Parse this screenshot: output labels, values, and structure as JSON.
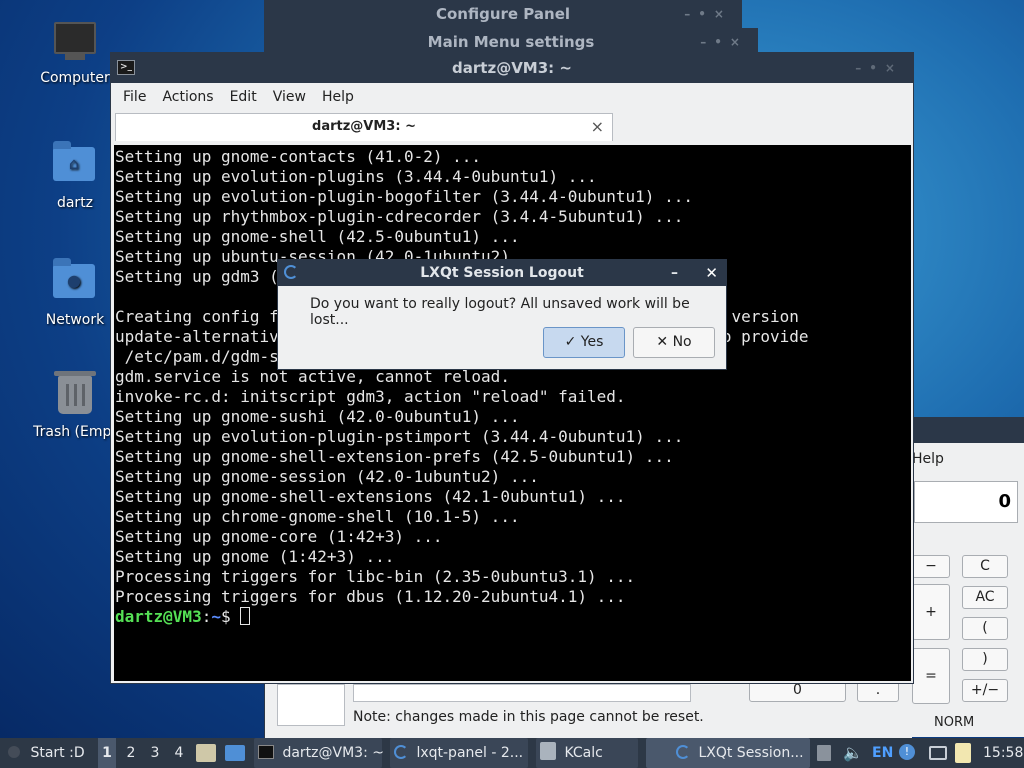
{
  "desktop": {
    "icons": [
      {
        "label": "Computer",
        "icon": "computer-icon"
      },
      {
        "label": "dartz",
        "icon": "home-folder-icon"
      },
      {
        "label": "Network",
        "icon": "network-folder-icon"
      },
      {
        "label": "Trash (Empt",
        "icon": "trash-icon"
      }
    ]
  },
  "background_windows": {
    "configure_panel_title": "Configure Panel",
    "main_menu_title": "Main Menu settings",
    "note": "Note: changes made in this page cannot be reset."
  },
  "terminal": {
    "window_title": "dartz@VM3: ~",
    "menu": [
      "File",
      "Actions",
      "Edit",
      "View",
      "Help"
    ],
    "tab_title": "dartz@VM3: ~",
    "lines": [
      "Setting up gnome-contacts (41.0-2) ...",
      "Setting up evolution-plugins (3.44.4-0ubuntu1) ...",
      "Setting up evolution-plugin-bogofilter (3.44.4-0ubuntu1) ...",
      "Setting up rhythmbox-plugin-cdrecorder (3.4.4-5ubuntu1) ...",
      "Setting up gnome-shell (42.5-0ubuntu1) ...",
      "Setting up ubuntu-session (42.0-1ubuntu2) ...",
      "Setting up gdm3 (42.0-1ubuntu7.22.04.1) ...",
      "",
      "Creating config file /etc/pam.d/gdm-launch-environment with new version",
      "update-alternatives: using /etc/pam.d/gdm-smartcard-exclusive to provide",
      " /etc/pam.d/gdm-smartcard (gdm-smartcard) in auto mode",
      "gdm.service is not active, cannot reload.",
      "invoke-rc.d: initscript gdm3, action \"reload\" failed.",
      "Setting up gnome-sushi (42.0-0ubuntu1) ...",
      "Setting up evolution-plugin-pstimport (3.44.4-0ubuntu1) ...",
      "Setting up gnome-shell-extension-prefs (42.5-0ubuntu1) ...",
      "Setting up gnome-session (42.0-1ubuntu2) ...",
      "Setting up gnome-shell-extensions (42.1-0ubuntu1) ...",
      "Setting up chrome-gnome-shell (10.1-5) ...",
      "Setting up gnome-core (1:42+3) ...",
      "Setting up gnome (1:42+3) ...",
      "Processing triggers for libc-bin (2.35-0ubuntu3.1) ...",
      "Processing triggers for dbus (1.12.20-2ubuntu4.1) ..."
    ],
    "prompt_user": "dartz@VM3",
    "prompt_sep": ":",
    "prompt_path": "~",
    "prompt_symbol": "$ "
  },
  "dialog": {
    "title": "LXQt Session Logout",
    "message": "Do you want to really logout? All unsaved work will be lost...",
    "yes_label": "Yes",
    "no_label": "No",
    "yes_icon": "✓",
    "no_icon": "✕"
  },
  "kcalc": {
    "menu_help": "Help",
    "display": "0",
    "buttons": {
      "minus": "−",
      "c": "C",
      "plus": "+",
      "ac": "AC",
      "lparen": "(",
      "rparen": ")",
      "equals": "=",
      "plusminus": "+/−",
      "zero": "0",
      "dot": "."
    },
    "mode": "NORM"
  },
  "taskbar": {
    "start_label": "Start :D",
    "desktops": [
      "1",
      "2",
      "3",
      "4"
    ],
    "tasks": [
      {
        "label": "dartz@VM3: ~"
      },
      {
        "label": "lxqt-panel - 2..."
      },
      {
        "label": "KCalc"
      },
      {
        "label": "LXQt Session..."
      }
    ],
    "keyboard_layout": "EN",
    "clock": "15:58"
  },
  "colors": {
    "titlebar": "#2b3748",
    "taskbar": "#2d3846",
    "prompt_user": "#55e055",
    "prompt_path": "#5a8cff"
  }
}
